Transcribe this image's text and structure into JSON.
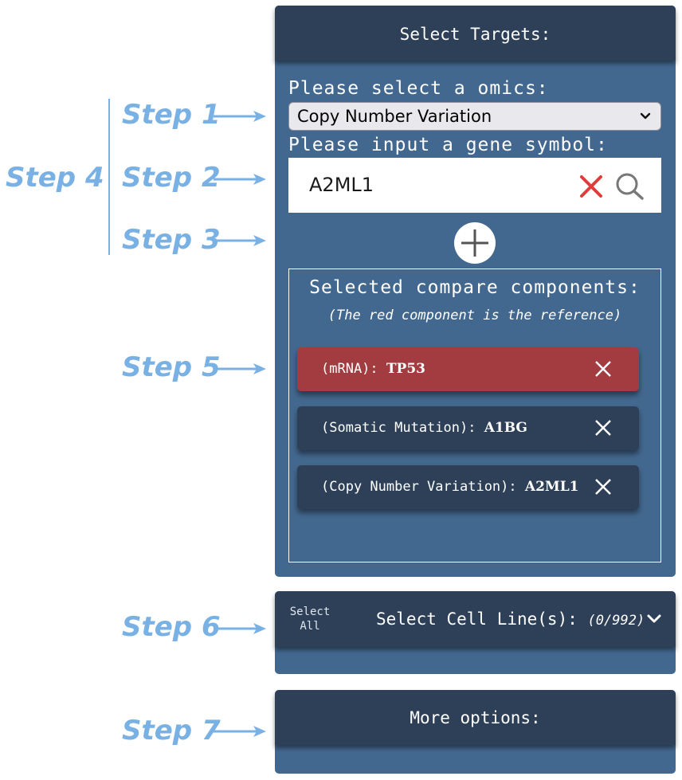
{
  "annotations": {
    "step1": "Step 1",
    "step2": "Step 2",
    "step3": "Step 3",
    "step4": "Step 4",
    "step5": "Step 5",
    "step6": "Step 6",
    "step7": "Step 7",
    "color": "#79b1e4"
  },
  "targets": {
    "header": "Select Targets:",
    "omics_label": "Please select a omics:",
    "omics_selected": "Copy Number Variation",
    "gene_label": "Please input a gene symbol:",
    "gene_value": "A2ML1",
    "clear_icon": "close-icon",
    "search_icon": "search-icon",
    "add_icon": "plus-icon"
  },
  "compare": {
    "title": "Selected compare components:",
    "subtitle": "(The red component is the reference)",
    "components": [
      {
        "omics": "(mRNA):",
        "gene": "TP53",
        "reference": true
      },
      {
        "omics": "(Somatic Mutation):",
        "gene": "A1BG",
        "reference": false
      },
      {
        "omics": "(Copy Number Variation):",
        "gene": "A2ML1",
        "reference": false
      }
    ]
  },
  "cell_lines": {
    "select_all": "Select All",
    "title": "Select Cell Line(s):",
    "count": "(0/992)"
  },
  "more_options": {
    "title": "More options:"
  },
  "colors": {
    "panel": "#43688f",
    "header": "#2d4058",
    "reference": "#a23c40",
    "clear": "#e03c3c"
  }
}
